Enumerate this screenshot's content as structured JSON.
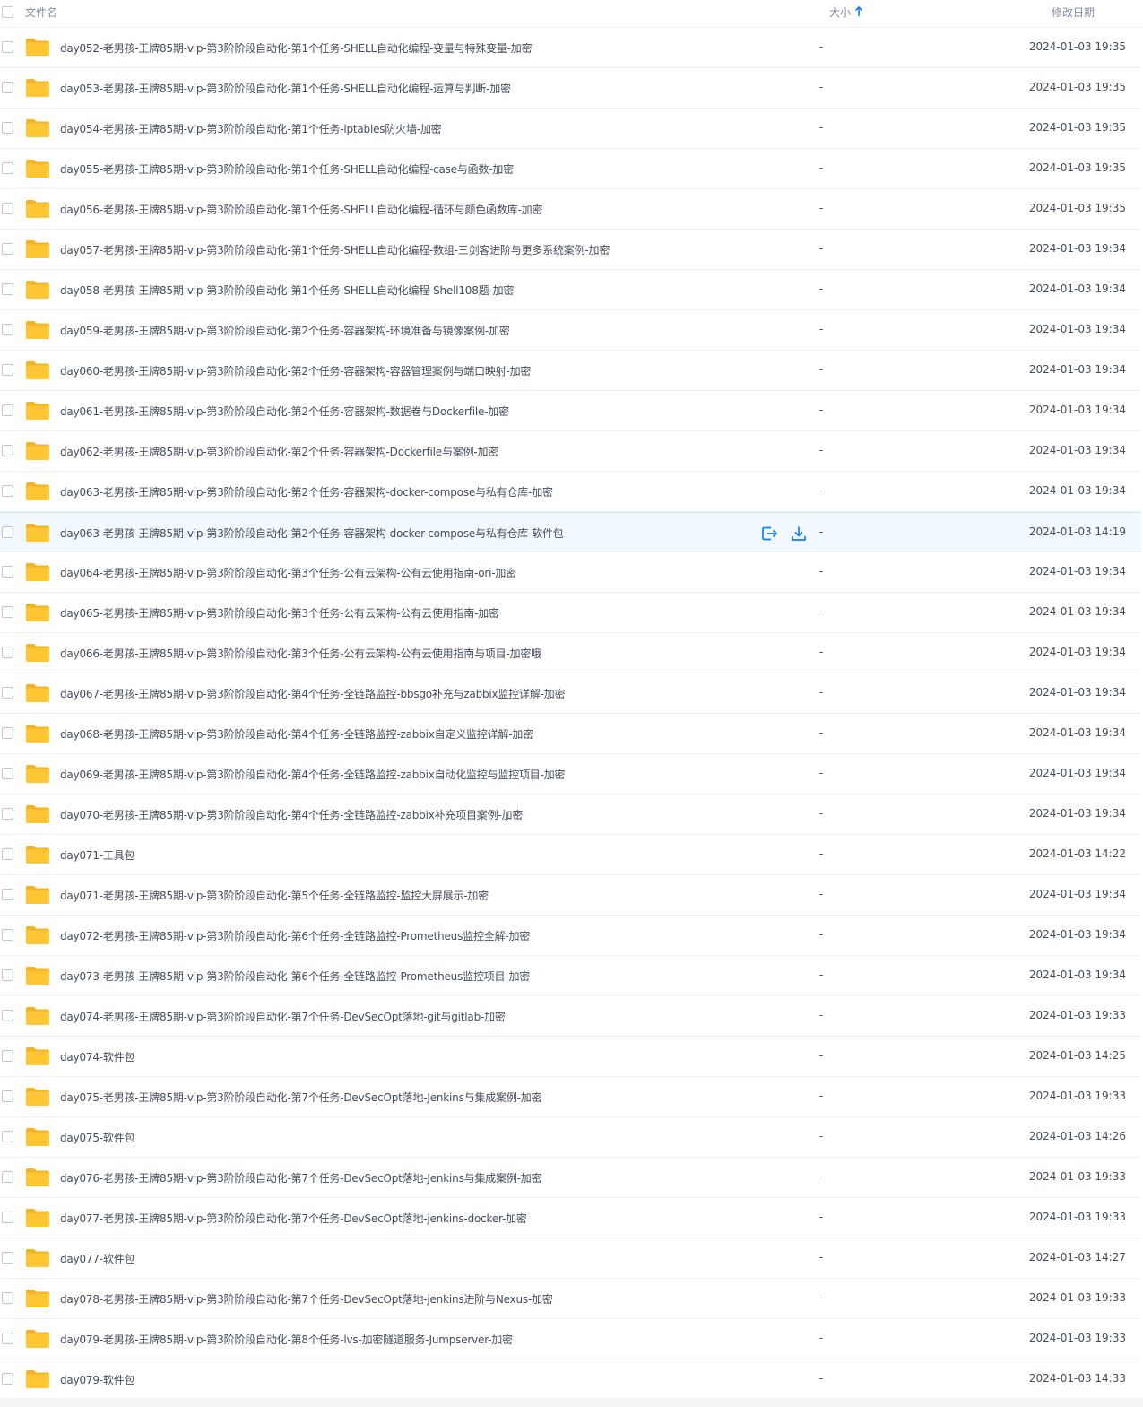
{
  "header": {
    "name_label": "文件名",
    "size_label": "大小",
    "date_label": "修改日期",
    "sort_icon": "arrow-up-icon"
  },
  "colors": {
    "folder": "#FFC633",
    "folder_back": "#F5B324",
    "accent": "#0D7FFF"
  },
  "files": [
    {
      "name": "day052-老男孩-王牌85期-vip-第3阶阶段自动化-第1个任务-SHELL自动化编程-变量与特殊变量-加密",
      "size": "-",
      "date": "2024-01-03 19:35"
    },
    {
      "name": "day053-老男孩-王牌85期-vip-第3阶阶段自动化-第1个任务-SHELL自动化编程-运算与判断-加密",
      "size": "-",
      "date": "2024-01-03 19:35"
    },
    {
      "name": "day054-老男孩-王牌85期-vip-第3阶阶段自动化-第1个任务-iptables防火墙-加密",
      "size": "-",
      "date": "2024-01-03 19:35"
    },
    {
      "name": "day055-老男孩-王牌85期-vip-第3阶阶段自动化-第1个任务-SHELL自动化编程-case与函数-加密",
      "size": "-",
      "date": "2024-01-03 19:35"
    },
    {
      "name": "day056-老男孩-王牌85期-vip-第3阶阶段自动化-第1个任务-SHELL自动化编程-循环与颜色函数库-加密",
      "size": "-",
      "date": "2024-01-03 19:35"
    },
    {
      "name": "day057-老男孩-王牌85期-vip-第3阶阶段自动化-第1个任务-SHELL自动化编程-数组-三剑客进阶与更多系统案例-加密",
      "size": "-",
      "date": "2024-01-03 19:34"
    },
    {
      "name": "day058-老男孩-王牌85期-vip-第3阶阶段自动化-第1个任务-SHELL自动化编程-Shell108题-加密",
      "size": "-",
      "date": "2024-01-03 19:34"
    },
    {
      "name": "day059-老男孩-王牌85期-vip-第3阶阶段自动化-第2个任务-容器架构-环境准备与镜像案例-加密",
      "size": "-",
      "date": "2024-01-03 19:34"
    },
    {
      "name": "day060-老男孩-王牌85期-vip-第3阶阶段自动化-第2个任务-容器架构-容器管理案例与端口映射-加密",
      "size": "-",
      "date": "2024-01-03 19:34"
    },
    {
      "name": "day061-老男孩-王牌85期-vip-第3阶阶段自动化-第2个任务-容器架构-数据卷与Dockerfile-加密",
      "size": "-",
      "date": "2024-01-03 19:34"
    },
    {
      "name": "day062-老男孩-王牌85期-vip-第3阶阶段自动化-第2个任务-容器架构-Dockerfile与案例-加密",
      "size": "-",
      "date": "2024-01-03 19:34"
    },
    {
      "name": "day063-老男孩-王牌85期-vip-第3阶阶段自动化-第2个任务-容器架构-docker-compose与私有仓库-加密",
      "size": "-",
      "date": "2024-01-03 19:34"
    },
    {
      "name": "day063-老男孩-王牌85期-vip-第3阶阶段自动化-第2个任务-容器架构-docker-compose与私有仓库-软件包",
      "size": "-",
      "date": "2024-01-03 14:19",
      "active": true
    },
    {
      "name": "day064-老男孩-王牌85期-vip-第3阶阶段自动化-第3个任务-公有云架构-公有云使用指南-ori-加密",
      "size": "-",
      "date": "2024-01-03 19:34"
    },
    {
      "name": "day065-老男孩-王牌85期-vip-第3阶阶段自动化-第3个任务-公有云架构-公有云使用指南-加密",
      "size": "-",
      "date": "2024-01-03 19:34"
    },
    {
      "name": "day066-老男孩-王牌85期-vip-第3阶阶段自动化-第3个任务-公有云架构-公有云使用指南与项目-加密哦",
      "size": "-",
      "date": "2024-01-03 19:34"
    },
    {
      "name": "day067-老男孩-王牌85期-vip-第3阶阶段自动化-第4个任务-全链路监控-bbsgo补充与zabbix监控详解-加密",
      "size": "-",
      "date": "2024-01-03 19:34"
    },
    {
      "name": "day068-老男孩-王牌85期-vip-第3阶阶段自动化-第4个任务-全链路监控-zabbix自定义监控详解-加密",
      "size": "-",
      "date": "2024-01-03 19:34"
    },
    {
      "name": "day069-老男孩-王牌85期-vip-第3阶阶段自动化-第4个任务-全链路监控-zabbix自动化监控与监控项目-加密",
      "size": "-",
      "date": "2024-01-03 19:34"
    },
    {
      "name": "day070-老男孩-王牌85期-vip-第3阶阶段自动化-第4个任务-全链路监控-zabbix补充项目案例-加密",
      "size": "-",
      "date": "2024-01-03 19:34"
    },
    {
      "name": "day071-工具包",
      "size": "-",
      "date": "2024-01-03 14:22"
    },
    {
      "name": "day071-老男孩-王牌85期-vip-第3阶阶段自动化-第5个任务-全链路监控-监控大屏展示-加密",
      "size": "-",
      "date": "2024-01-03 19:34"
    },
    {
      "name": "day072-老男孩-王牌85期-vip-第3阶阶段自动化-第6个任务-全链路监控-Prometheus监控全解-加密",
      "size": "-",
      "date": "2024-01-03 19:34"
    },
    {
      "name": "day073-老男孩-王牌85期-vip-第3阶阶段自动化-第6个任务-全链路监控-Prometheus监控项目-加密",
      "size": "-",
      "date": "2024-01-03 19:34"
    },
    {
      "name": "day074-老男孩-王牌85期-vip-第3阶阶段自动化-第7个任务-DevSecOpt落地-git与gitlab-加密",
      "size": "-",
      "date": "2024-01-03 19:33"
    },
    {
      "name": "day074-软件包",
      "size": "-",
      "date": "2024-01-03 14:25"
    },
    {
      "name": "day075-老男孩-王牌85期-vip-第3阶阶段自动化-第7个任务-DevSecOpt落地-Jenkins与集成案例-加密",
      "size": "-",
      "date": "2024-01-03 19:33"
    },
    {
      "name": "day075-软件包",
      "size": "-",
      "date": "2024-01-03 14:26"
    },
    {
      "name": "day076-老男孩-王牌85期-vip-第3阶阶段自动化-第7个任务-DevSecOpt落地-Jenkins与集成案例-加密",
      "size": "-",
      "date": "2024-01-03 19:33"
    },
    {
      "name": "day077-老男孩-王牌85期-vip-第3阶阶段自动化-第7个任务-DevSecOpt落地-jenkins-docker-加密",
      "size": "-",
      "date": "2024-01-03 19:33"
    },
    {
      "name": "day077-软件包",
      "size": "-",
      "date": "2024-01-03 14:27"
    },
    {
      "name": "day078-老男孩-王牌85期-vip-第3阶阶段自动化-第7个任务-DevSecOpt落地-jenkins进阶与Nexus-加密",
      "size": "-",
      "date": "2024-01-03 19:33"
    },
    {
      "name": "day079-老男孩-王牌85期-vip-第3阶阶段自动化-第8个任务-lvs-加密隧道服务-Jumpserver-加密",
      "size": "-",
      "date": "2024-01-03 19:33"
    },
    {
      "name": "day079-软件包",
      "size": "-",
      "date": "2024-01-03 14:33"
    }
  ]
}
